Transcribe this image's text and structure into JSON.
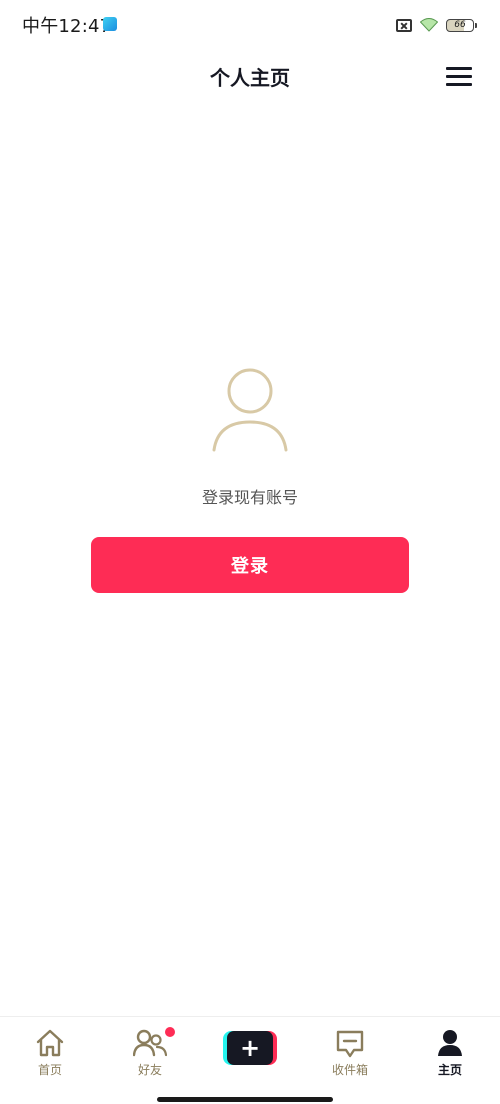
{
  "status_bar": {
    "time": "中午12:47",
    "battery": "66"
  },
  "header": {
    "title": "个人主页"
  },
  "main": {
    "prompt": "登录现有账号",
    "login_label": "登录"
  },
  "bottom_nav": {
    "items": [
      {
        "label": "首页",
        "icon": "home-icon"
      },
      {
        "label": "好友",
        "icon": "friends-icon"
      },
      {
        "label": "",
        "icon": "plus-icon"
      },
      {
        "label": "收件箱",
        "icon": "inbox-icon"
      },
      {
        "label": "主页",
        "icon": "profile-icon"
      }
    ],
    "create_symbol": "+"
  },
  "colors": {
    "accent": "#fe2c55",
    "icon_tan": "#8a7d5c",
    "avatar_outline": "#d8c9a6",
    "text_dark": "#161823"
  }
}
